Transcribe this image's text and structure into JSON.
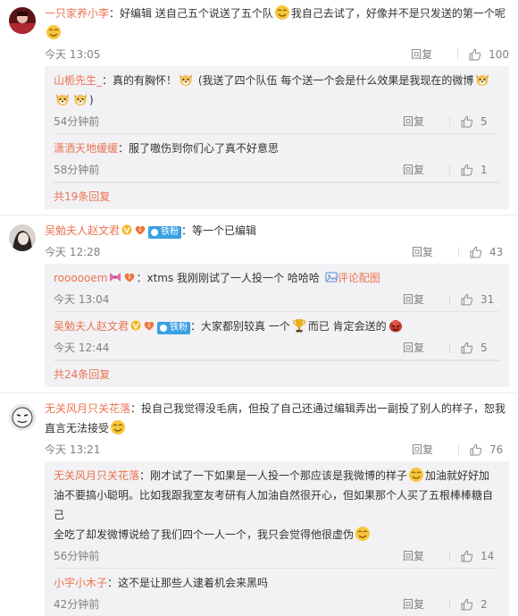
{
  "comments": [
    {
      "user": "一只家养小李",
      "text_parts": [
        "好编辑 送自己五个说送了五个队",
        "我自己去试了，好像并不是只发送的第一个呢"
      ],
      "time": "今天 13:05",
      "reply_label": "回复",
      "likes": "100",
      "replies": [
        {
          "user": "山栀先生_",
          "text_parts": [
            "真的有胸怀！",
            " (我送了四个队伍 每个送一个会是什么效果是我现在的微博",
            ")"
          ],
          "time": "54分钟前",
          "reply_label": "回复",
          "likes": "5"
        },
        {
          "user": "潇洒天地缓缓",
          "text": "服了嗷伤到你们心了真不好意思",
          "time": "58分钟前",
          "reply_label": "回复",
          "likes": "1"
        }
      ],
      "more": "共19条回复"
    },
    {
      "user": "吴勉夫人赵文君",
      "fan_badge": "铁粉",
      "text": "等一个已编辑",
      "time": "今天 12:28",
      "reply_label": "回复",
      "likes": "43",
      "replies": [
        {
          "user": "roooooem",
          "text": "xtms 我刚刚试了一人投一个 哈哈哈",
          "pic_label": "评论配图",
          "time": "今天 13:04",
          "reply_label": "回复",
          "likes": "31"
        },
        {
          "user": "吴勉夫人赵文君",
          "fan_badge": "铁粉",
          "text_parts": [
            "大家都别较真 一个",
            "而已 肯定会送的"
          ],
          "time": "今天 12:44",
          "reply_label": "回复",
          "likes": "5"
        }
      ],
      "more": "共24条回复"
    },
    {
      "user": "无关风月只关花落",
      "text_lines": [
        "投自己我觉得没毛病，但投了自己还通过编辑弄出一副投了别人的样子，恕我",
        "直言无法接受"
      ],
      "time": "今天 13:21",
      "reply_label": "回复",
      "likes": "76",
      "replies": [
        {
          "user": "无关风月只关花落",
          "text_lines": [
            "刚才试了一下如果是一人投一个那应该是我微博的样子",
            "加油就好好加",
            "油不要搞小聪明。比如我跟我室友考研有人加油自然很开心，但如果那个人买了五根棒棒糖自己",
            "全吃了却发微博说给了我们四个一人一个，我只会觉得他很虚伪"
          ],
          "time": "56分钟前",
          "reply_label": "回复",
          "likes": "14"
        },
        {
          "user": "小宇小木子",
          "text": "这不是让那些人逮着机会来黑吗",
          "time": "42分钟前",
          "reply_label": "回复",
          "likes": "2"
        }
      ]
    }
  ],
  "colors": {
    "username": "#eb7350",
    "meta": "#808080",
    "reply_bg": "#f2f2f5"
  },
  "icons": [
    "smile-emoji-icon",
    "dog-face-emoji-icon",
    "trophy-emoji-icon",
    "thumb-up-icon",
    "verified-v-icon",
    "level-heart-icon",
    "photo-icon"
  ]
}
